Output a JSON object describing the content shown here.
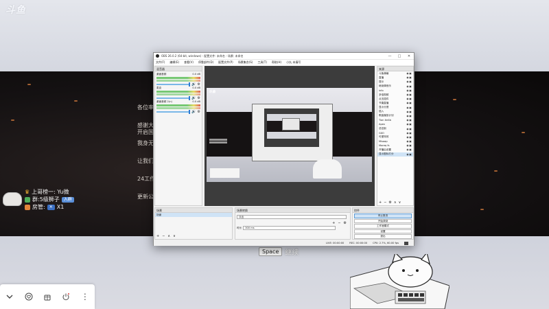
{
  "page": {
    "brand_logo": "斗鱼",
    "announcement_lines": [
      "各位率",
      "感谢大\n开启国",
      "我身无",
      "让我们",
      "24工作",
      "更新公"
    ],
    "space_hint": {
      "key": "Space",
      "label": "继续"
    }
  },
  "viewer_info": {
    "row1": "上哥榜一: Yu微",
    "row2_prefix": "群:5级狮子",
    "row2_tag": "入群",
    "row3_prefix": "房管:",
    "row3_suffix": "X1"
  },
  "bottom_bar": {
    "icons": [
      "chevron-down-icon",
      "heart-icon",
      "gift-box-icon",
      "power-icon",
      "more-icon"
    ]
  },
  "obs": {
    "title": "OBS 26.0.2 (64-bit, windows) - 配置文件: 未命名 - 场景: 未命名",
    "window_controls": [
      "—",
      "□",
      "✕"
    ],
    "menu": [
      "文件(F)",
      "编辑(E)",
      "查看(V)",
      "停靠部件(D)",
      "配置文件(P)",
      "场景集合(S)",
      "工具(T)",
      "帮助(H)",
      "小丸 未填写"
    ],
    "mixer": {
      "title": "混音器",
      "channels": [
        {
          "name": "桌面音频",
          "db": "0.0 dB"
        },
        {
          "name": "麦克",
          "db": "0.0 dB"
        },
        {
          "name": "桌面音频 2(n)",
          "db": "0.0 dB"
        }
      ]
    },
    "sources": {
      "title": "来源",
      "items": [
        "斗鱼弹幕",
        "直播",
        "提示",
        "继续弹音乐",
        "info",
        "多倍视频",
        "点击插件",
        "节奏直播",
        "显示分提",
        "插入",
        "歌曲播放计划",
        "Tian tie4b",
        "Apex",
        "总控制",
        "GXO",
        "可爱特效",
        "Misaap",
        "Moreq fs",
        "开播后设置",
        "显示图标打分"
      ],
      "selected_index": 19,
      "tools": [
        "+",
        "−",
        "⚙",
        "∧",
        "∨"
      ]
    },
    "scenes": {
      "title": "场景",
      "items": [
        "场景"
      ],
      "tools": [
        "+",
        "−",
        "∧",
        "∨"
      ]
    },
    "transitions": {
      "title": "场景转换",
      "selected": "淡出",
      "tools": [
        "+",
        "−",
        "⚙"
      ],
      "duration_label": "时长",
      "duration_value": "300 ms"
    },
    "controls": {
      "title": "控件",
      "buttons": [
        "停止推流",
        "开始录制",
        "工作室模式",
        "设置",
        "退出"
      ],
      "active_index": 0
    },
    "status": {
      "live": "LIVE: 00:00:00",
      "rec": "REC: 00:00:00",
      "cpu": "CPU: 2.7%, 60.00 fps"
    },
    "preview_logo": "斗鱼"
  }
}
